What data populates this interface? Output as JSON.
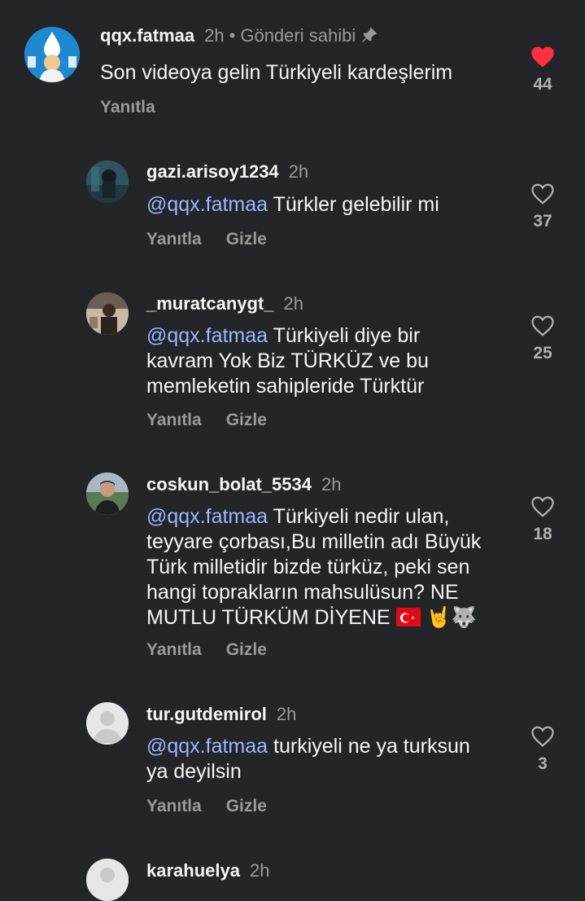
{
  "comments": [
    {
      "username": "qqx.fatmaa",
      "time": "2h",
      "owner_label": "Gönderi sahibi",
      "text": "Son videoya gelin Türkiyeli kardeşlerim",
      "reply": "Yanıtla",
      "likes": "44",
      "liked": true
    },
    {
      "username": "gazi.arisoy1234",
      "time": "2h",
      "mention": "@qqx.fatmaa",
      "text": "Türkler gelebilir mi",
      "reply": "Yanıtla",
      "hide": "Gizle",
      "likes": "37"
    },
    {
      "username": "_muratcanygt_",
      "time": "2h",
      "mention": "@qqx.fatmaa",
      "text": "Türkiyeli diye bir kavram Yok Biz TÜRKÜZ ve bu memleketin sahipleride Türktür",
      "reply": "Yanıtla",
      "hide": "Gizle",
      "likes": "25"
    },
    {
      "username": "coskun_bolat_5534",
      "time": "2h",
      "mention": "@qqx.fatmaa",
      "text": "Türkiyeli nedir ulan, teyyare çorbası,Bu milletin adı Büyük Türk milletidir bizde türküz, peki sen hangi toprakların mahsulüsun? NE MUTLU TÜRKÜM DİYENE",
      "emoji": "🤘🐺",
      "reply": "Yanıtla",
      "hide": "Gizle",
      "likes": "18"
    },
    {
      "username": "tur.gutdemirol",
      "time": "2h",
      "mention": "@qqx.fatmaa",
      "text": "turkiyeli ne ya turksun ya deyilsin",
      "reply": "Yanıtla",
      "hide": "Gizle",
      "likes": "3"
    },
    {
      "username": "karahuelya",
      "time": "2h"
    }
  ],
  "colors": {
    "background": "#242529",
    "mention": "#9ab6ff",
    "muted": "#9a9a9a",
    "heart_filled": "#ff3040"
  }
}
